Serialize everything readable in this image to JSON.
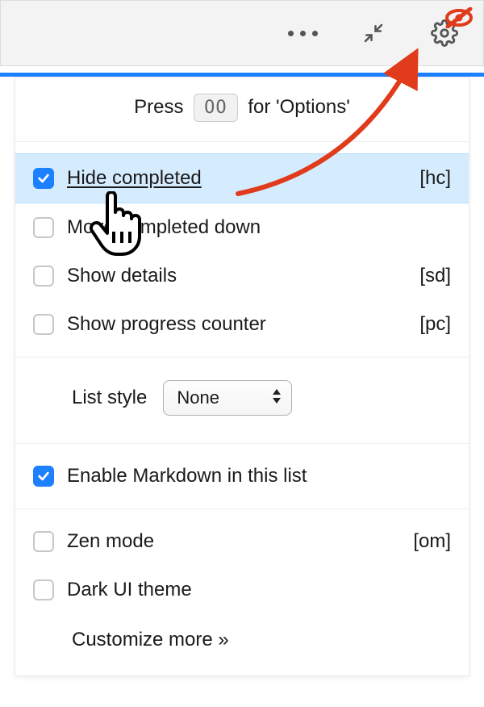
{
  "header": {
    "icons": {
      "more": "more-icon",
      "collapse": "collapse-icon",
      "gear": "gear-icon",
      "eye_off": "eye-off-icon"
    }
  },
  "hint": {
    "prefix": "Press",
    "key": "OO",
    "suffix": "for 'Options'"
  },
  "options": [
    {
      "id": "hide-completed",
      "label": "Hide completed",
      "shortcut": "[hc]",
      "checked": true,
      "selected": true
    },
    {
      "id": "move-completed-down",
      "label": "Move completed down",
      "shortcut": "",
      "checked": false,
      "selected": false
    },
    {
      "id": "show-details",
      "label": "Show details",
      "shortcut": "[sd]",
      "checked": false,
      "selected": false
    },
    {
      "id": "show-progress-counter",
      "label": "Show progress counter",
      "shortcut": "[pc]",
      "checked": false,
      "selected": false
    }
  ],
  "list_style": {
    "label": "List style",
    "value": "None"
  },
  "markdown": {
    "label": "Enable Markdown in this list",
    "checked": true
  },
  "display": [
    {
      "id": "zen-mode",
      "label": "Zen mode",
      "shortcut": "[om]",
      "checked": false
    },
    {
      "id": "dark-ui",
      "label": "Dark UI theme",
      "shortcut": "",
      "checked": false
    }
  ],
  "customize": "Customize more »",
  "colors": {
    "accent": "#1d80ff",
    "highlight": "#d5ecff",
    "arrow": "#e03b1a"
  }
}
